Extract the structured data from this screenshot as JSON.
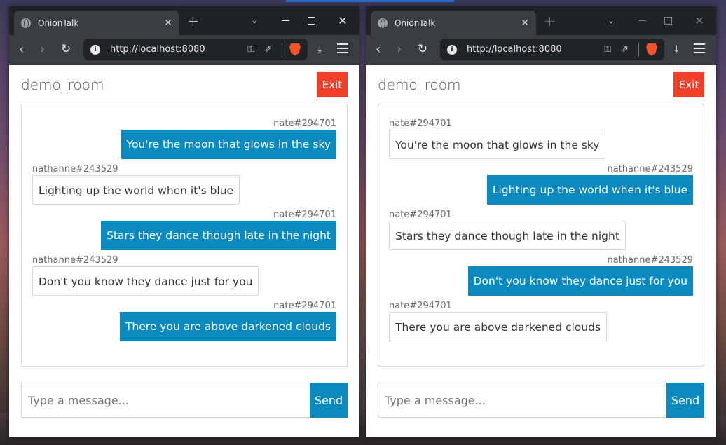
{
  "browser": {
    "tab_title": "OnionTalk",
    "tab_close": "✕",
    "new_tab": "+",
    "url": "http://localhost:8080",
    "back": "‹",
    "forward": "›",
    "reload": "↻",
    "window_chevron": "⌄",
    "window_close": "✕",
    "download": "⤓",
    "key_icon": "⚿",
    "share_icon": "⇗"
  },
  "app": {
    "room_name": "demo_room",
    "exit_label": "Exit",
    "input_placeholder": "Type a message...",
    "send_label": "Send",
    "accent_color": "#0b8ac0",
    "exit_color": "#f0402a"
  },
  "windows": [
    {
      "messages": [
        {
          "user": "nate#294701",
          "text": "You're the moon that glows in the sky",
          "side": "right"
        },
        {
          "user": "nathanne#243529",
          "text": "Lighting up the world when it's blue",
          "side": "left"
        },
        {
          "user": "nate#294701",
          "text": "Stars they dance though late in the night",
          "side": "right"
        },
        {
          "user": "nathanne#243529",
          "text": "Don't you know they dance just for you",
          "side": "left"
        },
        {
          "user": "nate#294701",
          "text": "There you are above darkened clouds",
          "side": "right"
        }
      ]
    },
    {
      "messages": [
        {
          "user": "nate#294701",
          "text": "You're the moon that glows in the sky",
          "side": "left"
        },
        {
          "user": "nathanne#243529",
          "text": "Lighting up the world when it's blue",
          "side": "right"
        },
        {
          "user": "nate#294701",
          "text": "Stars they dance though late in the night",
          "side": "left"
        },
        {
          "user": "nathanne#243529",
          "text": "Don't you know they dance just for you",
          "side": "right"
        },
        {
          "user": "nate#294701",
          "text": "There you are above darkened clouds",
          "side": "left"
        }
      ]
    }
  ]
}
